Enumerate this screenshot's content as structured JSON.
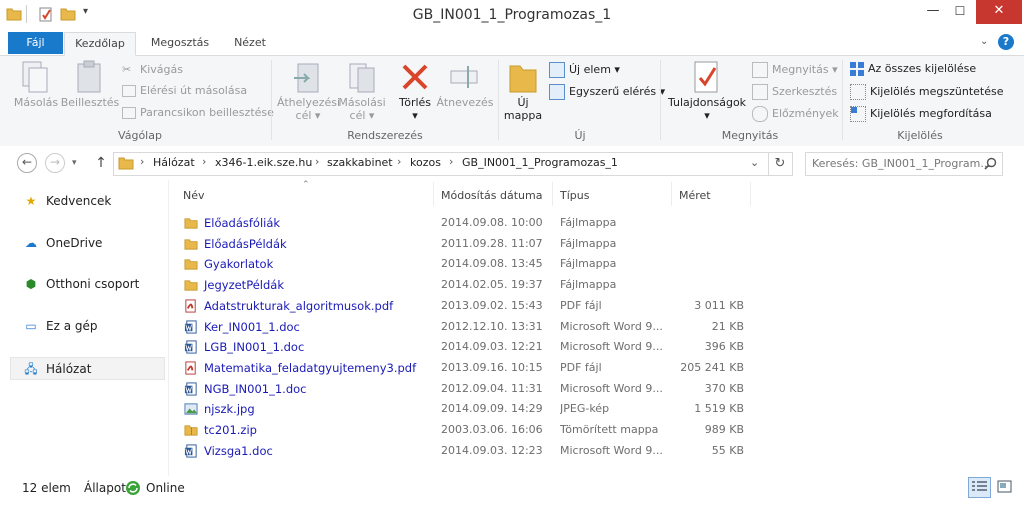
{
  "window": {
    "title": "GB_IN001_1_Programozas_1"
  },
  "controls": {
    "minimize": "—",
    "maximize": "☐",
    "close": "✕",
    "help": "?"
  },
  "tabs": [
    {
      "label": "Fájl"
    },
    {
      "label": "Kezdőlap"
    },
    {
      "label": "Megosztás"
    },
    {
      "label": "Nézet"
    }
  ],
  "ribbon": {
    "clipboard": {
      "copy": "Másolás",
      "paste": "Beillesztés",
      "cut": "Kivágás",
      "copy_path": "Elérési út másolása",
      "paste_shortcut": "Parancsikon beillesztése",
      "group": "Vágólap"
    },
    "organize": {
      "move_to_1": "Áthelyezési",
      "move_to_2": "cél",
      "copy_to_1": "Másolási",
      "copy_to_2": "cél",
      "delete": "Törlés",
      "rename": "Átnevezés",
      "group": "Rendszerezés"
    },
    "new": {
      "new_folder_1": "Új",
      "new_folder_2": "mappa",
      "new_item": "Új elem",
      "easy_access": "Egyszerű elérés",
      "group": "Új"
    },
    "open": {
      "properties": "Tulajdonságok",
      "open": "Megnyitás",
      "edit": "Szerkesztés",
      "history": "Előzmények",
      "group": "Megnyitás"
    },
    "select": {
      "select_all": "Az összes kijelölése",
      "select_none": "Kijelölés megszüntetése",
      "invert": "Kijelölés megfordítása",
      "group": "Kijelölés"
    }
  },
  "address": {
    "breadcrumbs": [
      "Hálózat",
      "x346-1.eik.sze.hu",
      "szakkabinet",
      "kozos",
      "GB_IN001_1_Programozas_1"
    ],
    "search_placeholder": "Keresés: GB_IN001_1_Program..."
  },
  "nav": {
    "favorites": "Kedvencek",
    "onedrive": "OneDrive",
    "homegroup": "Otthoni csoport",
    "this_pc": "Ez a gép",
    "network": "Hálózat"
  },
  "columns": {
    "name": "Név",
    "date": "Módosítás dátuma",
    "type": "Típus",
    "size": "Méret"
  },
  "files": [
    {
      "name": "Előadásfóliák",
      "date": "2014.09.08. 10:00",
      "type": "Fájlmappa",
      "size": "",
      "icon": "folder-icon"
    },
    {
      "name": "ElőadásPéldák",
      "date": "2011.09.28. 11:07",
      "type": "Fájlmappa",
      "size": "",
      "icon": "folder-icon"
    },
    {
      "name": "Gyakorlatok",
      "date": "2014.09.08. 13:45",
      "type": "Fájlmappa",
      "size": "",
      "icon": "folder-icon"
    },
    {
      "name": "JegyzetPéldák",
      "date": "2014.02.05. 19:37",
      "type": "Fájlmappa",
      "size": "",
      "icon": "folder-icon"
    },
    {
      "name": "Adatstrukturak_algoritmusok.pdf",
      "date": "2013.09.02. 15:43",
      "type": "PDF fájl",
      "size": "3 011 KB",
      "icon": "pdf-icon"
    },
    {
      "name": "Ker_IN001_1.doc",
      "date": "2012.12.10. 13:31",
      "type": "Microsoft Word 9...",
      "size": "21 KB",
      "icon": "word-icon"
    },
    {
      "name": "LGB_IN001_1.doc",
      "date": "2014.09.03. 12:21",
      "type": "Microsoft Word 9...",
      "size": "396 KB",
      "icon": "word-icon"
    },
    {
      "name": "Matematika_feladatgyujtemeny3.pdf",
      "date": "2013.09.16. 10:15",
      "type": "PDF fájl",
      "size": "205 241 KB",
      "icon": "pdf-icon"
    },
    {
      "name": "NGB_IN001_1.doc",
      "date": "2012.09.04. 11:31",
      "type": "Microsoft Word 9...",
      "size": "370 KB",
      "icon": "word-icon"
    },
    {
      "name": "njszk.jpg",
      "date": "2014.09.09. 14:29",
      "type": "JPEG-kép",
      "size": "1 519 KB",
      "icon": "image-icon"
    },
    {
      "name": "tc201.zip",
      "date": "2003.03.06. 16:06",
      "type": "Tömörített mappa",
      "size": "989 KB",
      "icon": "zip-icon"
    },
    {
      "name": "Vizsga1.doc",
      "date": "2014.09.03. 12:23",
      "type": "Microsoft Word 9...",
      "size": "55 KB",
      "icon": "word-icon"
    }
  ],
  "status": {
    "count": "12 elem",
    "state_label": "Állapot:",
    "state_value": "Online"
  },
  "colors": {
    "accent": "#1979ca",
    "link": "#1a1ab7",
    "close": "#c7372f",
    "folder": "#e8b94a"
  }
}
